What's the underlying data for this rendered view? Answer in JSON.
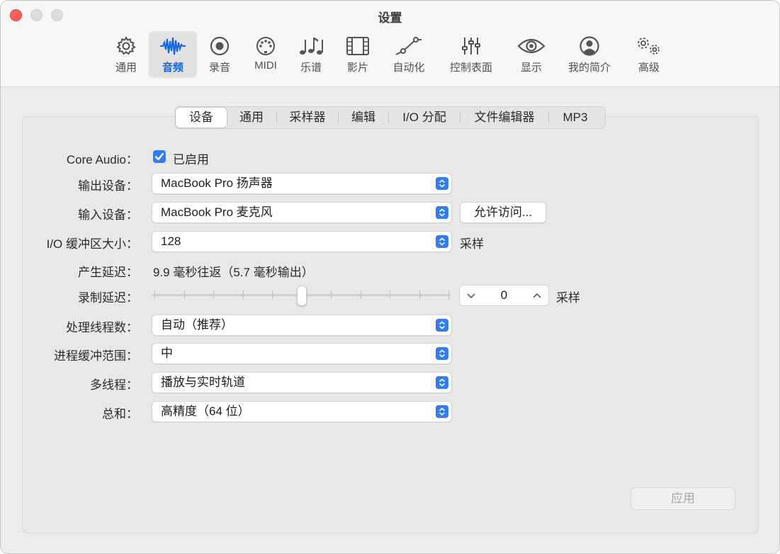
{
  "window": {
    "title": "设置"
  },
  "toolbar": {
    "items": [
      {
        "label": "通用",
        "icon": "gear-icon"
      },
      {
        "label": "音频",
        "icon": "waveform-icon",
        "active": true
      },
      {
        "label": "录音",
        "icon": "record-icon"
      },
      {
        "label": "MIDI",
        "icon": "midi-connector-icon"
      },
      {
        "label": "乐谱",
        "icon": "music-notes-icon"
      },
      {
        "label": "影片",
        "icon": "film-icon"
      },
      {
        "label": "自动化",
        "icon": "automation-curve-icon"
      },
      {
        "label": "控制表面",
        "icon": "sliders-icon"
      },
      {
        "label": "显示",
        "icon": "eye-icon"
      },
      {
        "label": "我的简介",
        "icon": "person-circle-icon"
      },
      {
        "label": "高级",
        "icon": "gears-icon"
      }
    ]
  },
  "tabs": [
    {
      "label": "设备",
      "active": true
    },
    {
      "label": "通用"
    },
    {
      "label": "采样器"
    },
    {
      "label": "编辑"
    },
    {
      "label": "I/O 分配"
    },
    {
      "label": "文件编辑器"
    },
    {
      "label": "MP3"
    }
  ],
  "form": {
    "core_audio": {
      "label": "Core Audio：",
      "checkbox_label": "已启用",
      "checked": true
    },
    "output_device": {
      "label": "输出设备：",
      "value": "MacBook Pro 扬声器"
    },
    "input_device": {
      "label": "输入设备：",
      "value": "MacBook Pro 麦克风",
      "button": "允许访问..."
    },
    "io_buffer": {
      "label": "I/O 缓冲区大小：",
      "value": "128",
      "unit": "采样"
    },
    "latency": {
      "label": "产生延迟：",
      "value": "9.9 毫秒往返（5.7 毫秒输出）"
    },
    "record_delay": {
      "label": "录制延迟：",
      "value": "0",
      "unit": "采样",
      "slider_position": 0.5
    },
    "threads": {
      "label": "处理线程数：",
      "value": "自动（推荐）"
    },
    "process_buffer": {
      "label": "进程缓冲范围：",
      "value": "中"
    },
    "multithreading": {
      "label": "多线程：",
      "value": "播放与实时轨道"
    },
    "summing": {
      "label": "总和：",
      "value": "高精度（64 位）"
    }
  },
  "apply_button": "应用",
  "colors": {
    "accent": "#2f7cf6",
    "active_label": "#1464dc",
    "close": "#fe5f57"
  }
}
